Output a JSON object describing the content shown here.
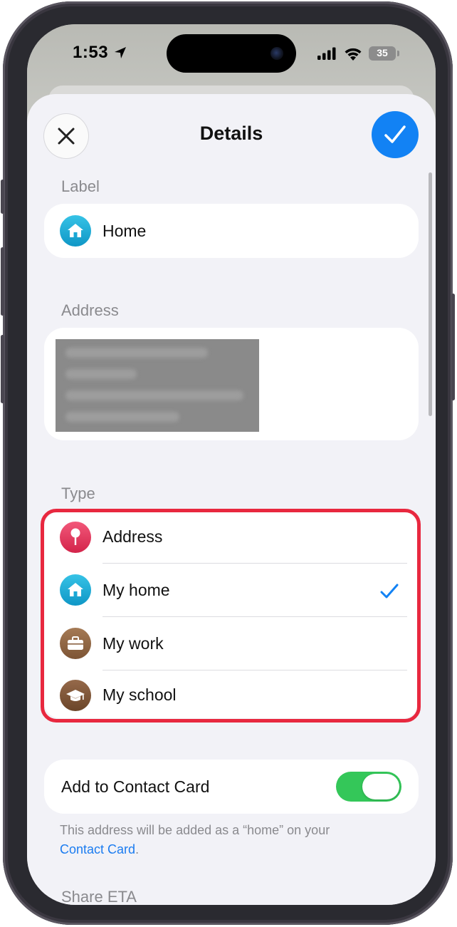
{
  "status_bar": {
    "time": "1:53",
    "battery": "35"
  },
  "header": {
    "title": "Details"
  },
  "label_section": {
    "heading": "Label",
    "value": "Home"
  },
  "address_section": {
    "heading": "Address"
  },
  "type_section": {
    "heading": "Type",
    "options": [
      {
        "label": "Address",
        "icon": "pin-icon",
        "color": "#e23a5c",
        "selected": false
      },
      {
        "label": "My home",
        "icon": "house-icon",
        "color": "#1aa8d6",
        "selected": true
      },
      {
        "label": "My work",
        "icon": "briefcase-icon",
        "color": "#8a6040",
        "selected": false
      },
      {
        "label": "My school",
        "icon": "graduation-cap-icon",
        "color": "#7a5233",
        "selected": false
      }
    ]
  },
  "contact_card": {
    "toggle_label": "Add to Contact Card",
    "toggle_on": true,
    "footnote_text": "This address will be added as a “home” on your",
    "footnote_link": "Contact Card",
    "footnote_end": "."
  },
  "share_eta": {
    "heading": "Share ETA"
  },
  "colors": {
    "accent": "#1282f4",
    "highlight": "#e8283f",
    "toggle": "#34c759"
  }
}
